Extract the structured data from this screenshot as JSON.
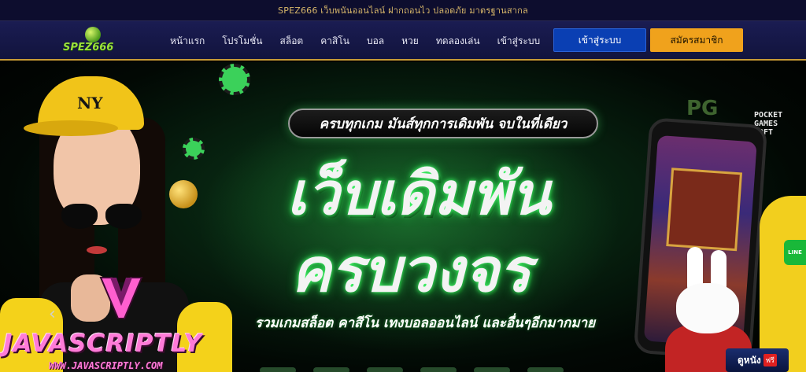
{
  "topbar": {
    "announcement": "SPEZ666 เว็บพนันออนไลน์ ฝากถอนไว ปลอดภัย มาตรฐานสากล"
  },
  "header": {
    "logo_text": "SPEZ666",
    "nav": [
      {
        "label": "หน้าแรก"
      },
      {
        "label": "โปรโมชั่น"
      },
      {
        "label": "สล็อต"
      },
      {
        "label": "คาสิโน"
      },
      {
        "label": "บอล"
      },
      {
        "label": "หวย"
      },
      {
        "label": "ทดลองเล่น"
      },
      {
        "label": "เข้าสู่ระบบ"
      }
    ],
    "login_button": "เข้าสู่ระบบ",
    "register_button": "สมัครสมาชิก",
    "colors": {
      "login": "#0a3fb3",
      "register": "#f0a21c",
      "accent": "#c79b36"
    }
  },
  "hero": {
    "tagline": "ครบทุกเกม มันส์ทุกการเดิมพัน จบในที่เดียว",
    "headline_line1": "เว็บเดิมพัน",
    "headline_line2": "ครบวงจร",
    "subline": "รวมเกมสล็อต คาสีโน เทงบอลออนไลน์ และอื่นๆอีกมากมาย",
    "pg_logo": "PG",
    "pocket_logo": "POCKET GAMES SOFT",
    "carousel_prev_icon": "chevron-left-icon",
    "side_tab_label": "LINE",
    "movie_badge_main": "ดูหนัง",
    "movie_badge_tag": "ฟรี"
  },
  "watermark": {
    "brand": "JAVASCRIPTLY",
    "url": "WWW.JAVASCRIPTLY.COM"
  }
}
